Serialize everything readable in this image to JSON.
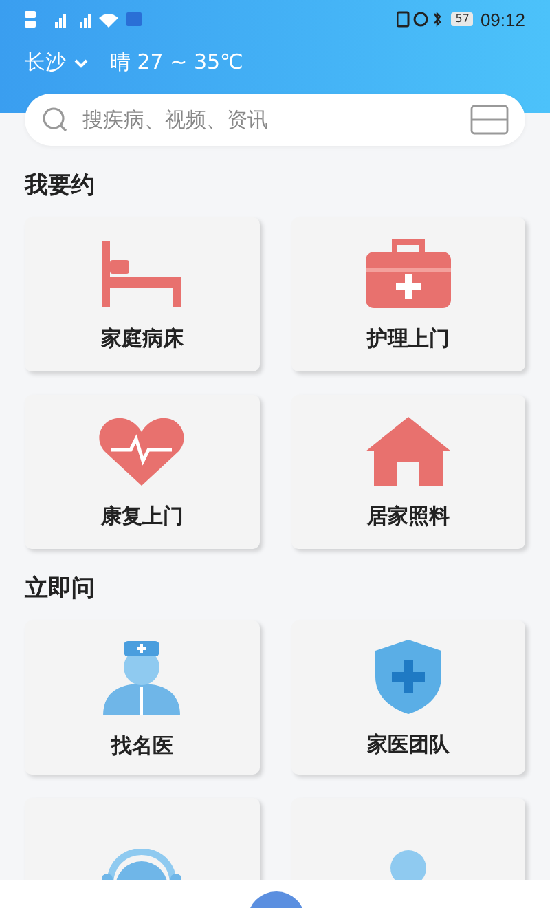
{
  "status_bar": {
    "battery": "57",
    "time": "09:12"
  },
  "header": {
    "city": "长沙",
    "weather": "晴 27 ~ 35℃"
  },
  "search": {
    "placeholder": "搜疾病、视频、资讯"
  },
  "sections": [
    {
      "title": "我要约",
      "cards": [
        {
          "kind": "bed",
          "label": "家庭病床"
        },
        {
          "kind": "medkit",
          "label": "护理上门"
        },
        {
          "kind": "heart",
          "label": "康复上门"
        },
        {
          "kind": "house",
          "label": "居家照料"
        }
      ]
    },
    {
      "title": "立即问",
      "cards": [
        {
          "kind": "doctor",
          "label": "找名医"
        },
        {
          "kind": "shield",
          "label": "家医团队"
        },
        {
          "kind": "headset"
        },
        {
          "kind": "person"
        }
      ]
    }
  ]
}
